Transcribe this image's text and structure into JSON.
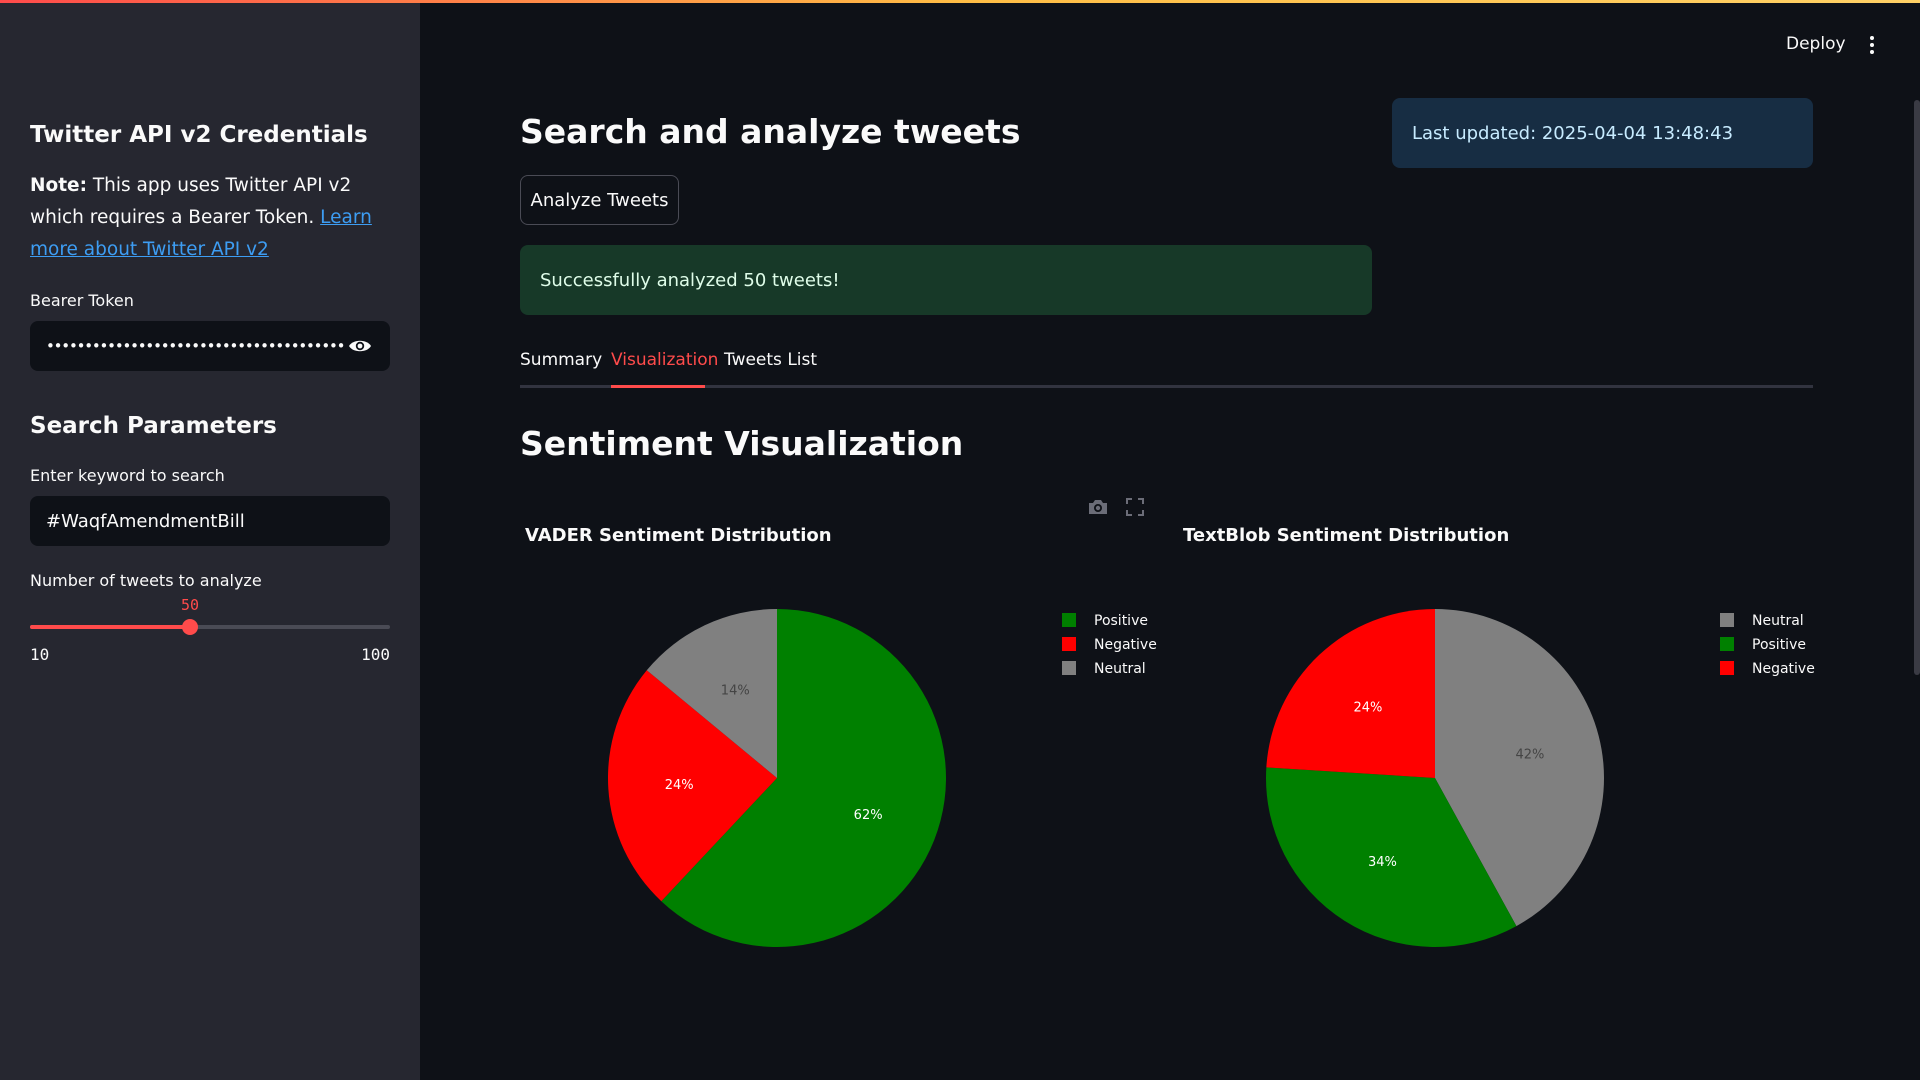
{
  "sidebar": {
    "credentials_heading": "Twitter API v2 Credentials",
    "note_bold": "Note:",
    "note_text": " This app uses Twitter API v2 which requires a Bearer Token. ",
    "note_link": "Learn more about Twitter API v2",
    "bearer_label": "Bearer Token",
    "bearer_value": "••••••••••••••••••••••••••••••••••••••••••••••••",
    "search_heading": "Search Parameters",
    "keyword_label": "Enter keyword to search",
    "keyword_value": "#WaqfAmendmentBill",
    "slider_label": "Number of tweets to analyze",
    "slider": {
      "value": 50,
      "min": 10,
      "max": 100
    }
  },
  "header": {
    "deploy_label": "Deploy",
    "menu_icon": "kebab-menu-icon"
  },
  "main": {
    "title": "Search and analyze tweets",
    "analyze_button": "Analyze Tweets",
    "last_updated": "Last updated: 2025-04-04 13:48:43",
    "success_message": "Successfully analyzed 50 tweets!",
    "tabs": [
      {
        "label": "Summary",
        "active": false
      },
      {
        "label": "Visualization",
        "active": true
      },
      {
        "label": "Tweets List",
        "active": false
      }
    ],
    "section_title": "Sentiment Visualization",
    "modebar_icons": [
      "camera-icon",
      "fullscreen-icon"
    ]
  },
  "colors": {
    "accent": "#ff4b4b",
    "positive": "#008000",
    "negative": "#ff0000",
    "neutral": "#808080"
  },
  "chart_data": [
    {
      "type": "pie",
      "title": "VADER Sentiment Distribution",
      "labels": [
        "Positive",
        "Negative",
        "Neutral"
      ],
      "values": [
        62,
        24,
        14
      ],
      "value_labels": [
        "62%",
        "24%",
        "14%"
      ],
      "colors": [
        "#008000",
        "#ff0000",
        "#808080"
      ],
      "legend": "top-right"
    },
    {
      "type": "pie",
      "title": "TextBlob Sentiment Distribution",
      "labels": [
        "Neutral",
        "Positive",
        "Negative"
      ],
      "values": [
        42,
        34,
        24
      ],
      "value_labels": [
        "42%",
        "34%",
        "24%"
      ],
      "colors": [
        "#808080",
        "#008000",
        "#ff0000"
      ],
      "legend": "top-right"
    }
  ]
}
